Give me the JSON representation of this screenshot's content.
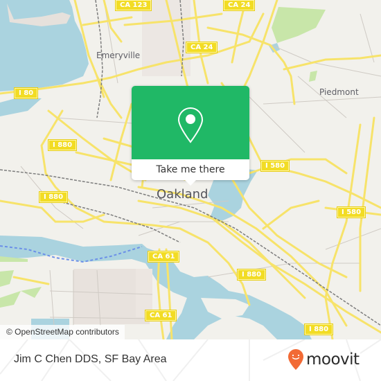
{
  "map": {
    "colors": {
      "land": "#f2f1ec",
      "water": "#aad3df",
      "road_major": "#f7e36a",
      "road_minor": "#cfcac4",
      "park": "#c8e6a9",
      "rail": "#7d7d7d",
      "shield_bg": "#f2dc24"
    },
    "places": [
      {
        "name": "Emeryville",
        "kind": "town"
      },
      {
        "name": "Piedmont",
        "kind": "town"
      },
      {
        "name": "Oakland",
        "kind": "city"
      }
    ],
    "route_shields": [
      {
        "label": "CA 123"
      },
      {
        "label": "CA 24"
      },
      {
        "label": "CA 24"
      },
      {
        "label": "I 80"
      },
      {
        "label": "I 880"
      },
      {
        "label": "I 880"
      },
      {
        "label": "I 580"
      },
      {
        "label": "I 580"
      },
      {
        "label": "CA 61"
      },
      {
        "label": "CA 61"
      },
      {
        "label": "I 880"
      },
      {
        "label": "I 880"
      }
    ],
    "attribution": "© OpenStreetMap contributors"
  },
  "popup": {
    "icon": "map-pin-icon",
    "accent": "#20b866",
    "cta_label": "Take me there"
  },
  "footer": {
    "title": "Jim C Chen DDS, SF Bay Area",
    "brand": {
      "name": "moovit",
      "logo_icon": "moovit-smiley-pin-icon",
      "logo_color": "#f26a35"
    }
  }
}
